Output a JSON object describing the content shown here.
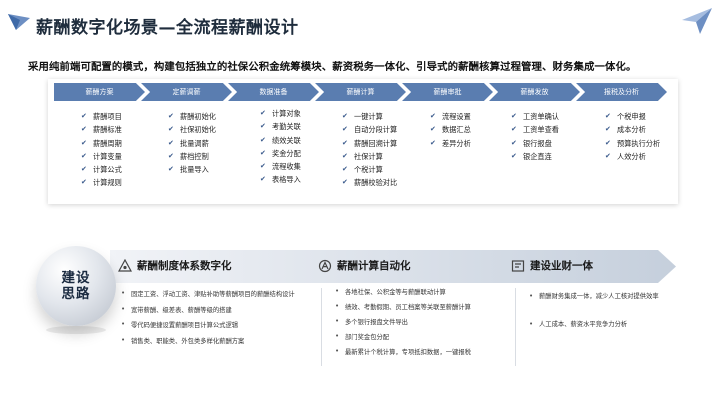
{
  "header": {
    "title": "薪酬数字化场景—全流程薪酬设计"
  },
  "subtitle": "采用纯前端可配置的模式，构建包括独立的社保公积金统筹模块、薪资税务一体化、引导式的薪酬核算过程管理、财务集成一体化。",
  "process": {
    "steps": [
      "薪酬方案",
      "定薪调薪",
      "数据准备",
      "薪酬计算",
      "薪酬审批",
      "薪酬发放",
      "报税及分析"
    ],
    "columns": [
      [
        "薪酬项目",
        "薪酬标准",
        "薪酬周期",
        "计算变量",
        "计算公式",
        "计算规则"
      ],
      [
        "薪酬初始化",
        "社保初始化",
        "批量调薪",
        "薪档控制",
        "批量导入"
      ],
      [
        "计算对象",
        "考勤关联",
        "绩效关联",
        "奖金分配",
        "流程收集",
        "表格导入"
      ],
      [
        "一键计算",
        "自动分段计算",
        "薪酬回溯计算",
        "社保计算",
        "个税计算",
        "薪酬校验对比"
      ],
      [
        "流程设置",
        "数据汇总",
        "差异分析"
      ],
      [
        "工资单确认",
        "工资单查看",
        "银行报盘",
        "银企直连"
      ],
      [
        "个税申报",
        "成本分析",
        "预算执行分析",
        "人效分析"
      ]
    ]
  },
  "approach": {
    "label_line1": "建设",
    "label_line2": "思路"
  },
  "sections": [
    {
      "title": "薪酬制度体系数字化",
      "icon": "system-icon",
      "items": [
        "固定工资、浮动工资、津贴补助等薪酬项目的薪酬结构设计",
        "宽带薪酬、级差表、薪酬等级的搭建",
        "零代码便捷设置薪酬项目计算公式逻辑",
        "销售类、职能类、外包类多样化薪酬方案"
      ]
    },
    {
      "title": "薪酬计算自动化",
      "icon": "automation-icon",
      "items": [
        "各地社保、公积金等与薪酬联动计算",
        "绩效、考勤假期、员工档案等关联至薪酬计算",
        "多个银行报盘文件导出",
        "部门奖金包分配",
        "最新累计个税计算，专项抵扣数据，一键报税"
      ]
    },
    {
      "title": "建设业财一体",
      "icon": "finance-icon",
      "items": [
        "薪酬财务集成一体，减少人工核对提供效率",
        "人工成本、薪资水平竞争力分析"
      ]
    }
  ],
  "colors": {
    "step": "#5a7db0",
    "banner_start": "#e8ecf2",
    "banner_end": "#c5cfdc",
    "check": "#3a5a8c"
  }
}
